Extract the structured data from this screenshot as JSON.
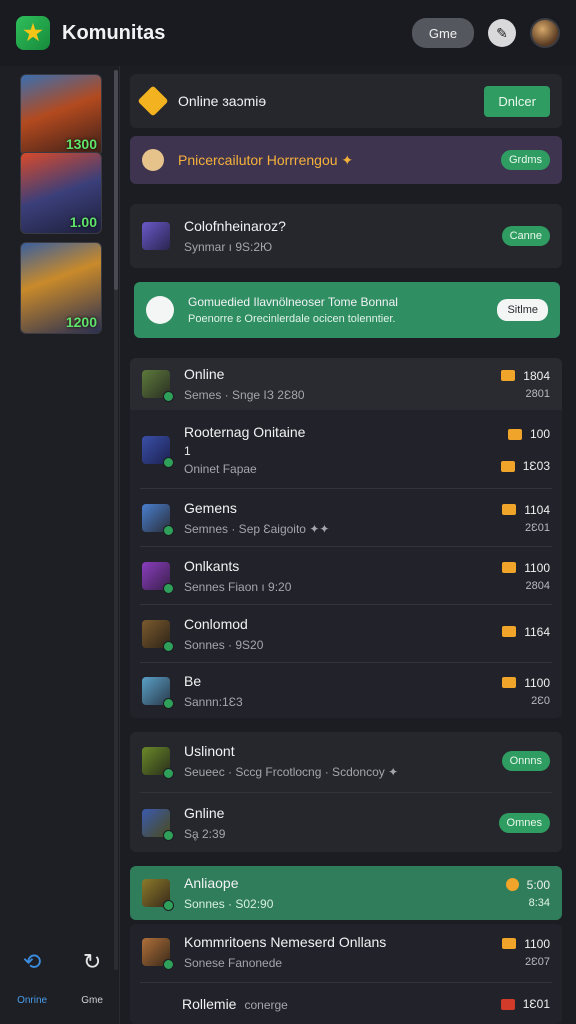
{
  "header": {
    "app_title": "Komunitas",
    "game_button": "Gme"
  },
  "rail": {
    "cards": [
      {
        "score": "1300"
      },
      {
        "score": "1.00"
      },
      {
        "score": "1200"
      }
    ],
    "nav": [
      {
        "label": "Onrine",
        "icon": "swirl-icon"
      },
      {
        "label": "Gme",
        "icon": "refresh-icon"
      }
    ]
  },
  "online_bar": {
    "title": "Online ɜaɔmiɘ",
    "button": "Dnlcer"
  },
  "promo": {
    "title": "Pnicercailutor Horrrengou ✦",
    "button": "Grdms"
  },
  "featured": {
    "title": "Colofnheinaroz?",
    "sub": "Synmar ı 9S:2Ю",
    "button": "Canne"
  },
  "banner": {
    "title": "Gomuedied Ilavnölneoser Tome Bonnal",
    "sub": "Poenorre ɛ Orecinlerdale ocicen tolenntier.",
    "button": "Sitlme"
  },
  "list": [
    {
      "title": "Online",
      "sub": "Semes · Snge ІЗ 2Ɛ80",
      "value": "1804",
      "sub_value": "2801"
    },
    {
      "title": "Rooternag Onitaine",
      "line2": "1",
      "sub": "Oninet Fapae",
      "value": "100",
      "sub_value": "1Ɛ03"
    },
    {
      "title": "Gemens",
      "sub": "Semnes · Sep Ɛaigoito ✦✦",
      "value": "1104",
      "sub_value": "2Ɛ01"
    },
    {
      "title": "Onlkants",
      "sub": "Sennes Fiaon ı 9:20",
      "value": "1100",
      "sub_value": "2804"
    },
    {
      "title": "Conlomod",
      "sub": "Sonnes · 9S20",
      "value": "1164",
      "sub_value": ""
    },
    {
      "title": "Be",
      "sub": "Sannn:1Ɛ3",
      "value": "1100",
      "sub_value": "2Ɛ0"
    }
  ],
  "group": [
    {
      "title": "Uslinont",
      "sub": "Seueec · Sccg Frcotlocng · Scdoncoy ✦",
      "button": "Onnns"
    },
    {
      "title": "Gnline",
      "sub": "Sḁ 2:39",
      "button": "Omnes"
    }
  ],
  "highlight": {
    "title": "Anliaope",
    "sub": "Sonnes · S02:90",
    "value": "5:00",
    "sub_value": "8:34"
  },
  "bottom_rows": [
    {
      "title": "Kommritoens Nemeserd Onllans",
      "sub": "Sonese Fanonede",
      "value": "1100",
      "sub_value": "2Ɛ07"
    },
    {
      "title": "Rollemie",
      "sub": "conerge",
      "value": "1Ɛ01",
      "sub_value": ""
    }
  ]
}
